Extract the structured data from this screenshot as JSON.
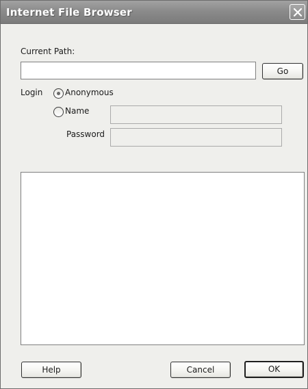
{
  "window": {
    "title": "Internet File Browser"
  },
  "path": {
    "label": "Current Path:",
    "value": "",
    "go_label": "Go"
  },
  "login": {
    "label": "Login",
    "anonymous_label": "Anonymous",
    "anonymous_selected": true,
    "name_label": "Name",
    "name_value": "",
    "password_label": "Password",
    "password_value": ""
  },
  "file_list": {
    "items": []
  },
  "footer": {
    "help_label": "Help",
    "cancel_label": "Cancel",
    "ok_label": "OK"
  },
  "icons": {
    "close": "close-icon"
  }
}
